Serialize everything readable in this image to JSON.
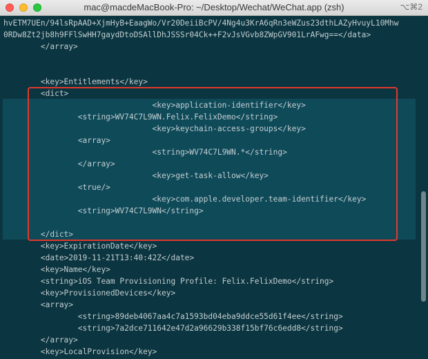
{
  "window": {
    "title": "mac@macdeMacBook-Pro: ~/Desktop/Wechat/WeChat.app (zsh)",
    "shortcut": "⌥⌘2"
  },
  "lines": [
    "hvETM7UEn/94lsRpAAD+XjmHyB+EaagWo/Vr20DeiiBcPV/4Ng4u3KrA6qRn3eWZus23dthLAZyHvuyL10Mhw",
    "0RDw8Zt2jb8h9FFlSwHH7gaydDtoDSAllDhJSSSr04Ck++F2vJsVGvb8ZWpGV901LrAFwg==</data>",
    "        </array>",
    "",
    "",
    "        <key>Entitlements</key>",
    "        <dict>",
    "                                <key>application-identifier</key>",
    "                <string>WV74C7L9WN.Felix.FelixDemo</string>",
    "                                <key>keychain-access-groups</key>",
    "                <array>",
    "                                <string>WV74C7L9WN.*</string>",
    "                </array>",
    "                                <key>get-task-allow</key>",
    "                <true/>",
    "                                <key>com.apple.developer.team-identifier</key>",
    "                <string>WV74C7L9WN</string>",
    "",
    "        </dict>",
    "        <key>ExpirationDate</key>",
    "        <date>2019-11-21T13:40:42Z</date>",
    "        <key>Name</key>",
    "        <string>iOS Team Provisioning Profile: Felix.FelixDemo</string>",
    "        <key>ProvisionedDevices</key>",
    "        <array>",
    "                <string>89deb4067aa4c7a1593bd04eba9ddce55d61f4ee</string>",
    "                <string>7a2dce711642e47d2a96629b338f15bf76c6edd8</string>",
    "        </array>",
    "        <key>LocalProvision</key>"
  ]
}
